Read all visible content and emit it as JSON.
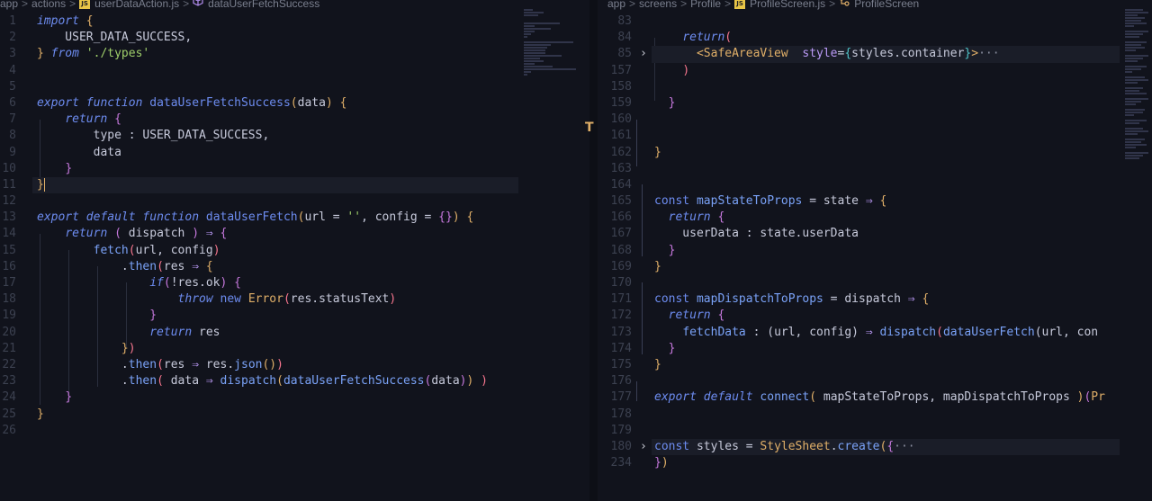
{
  "left": {
    "breadcrumb": [
      "app",
      "actions",
      "userDataAction.js",
      "dataUserFetchSuccess"
    ],
    "lines": [
      {
        "n": "1",
        "t": [
          [
            "kw",
            "import"
          ],
          [
            "pl",
            " "
          ],
          [
            "br1",
            "{"
          ]
        ]
      },
      {
        "n": "2",
        "t": [
          [
            "pl",
            "    USER_DATA_SUCCESS,"
          ]
        ]
      },
      {
        "n": "3",
        "t": [
          [
            "br1",
            "}"
          ],
          [
            "pl",
            " "
          ],
          [
            "kw",
            "from"
          ],
          [
            "pl",
            " "
          ],
          [
            "str",
            "'./types'"
          ]
        ]
      },
      {
        "n": "4",
        "t": []
      },
      {
        "n": "5",
        "t": []
      },
      {
        "n": "6",
        "t": [
          [
            "kw",
            "export"
          ],
          [
            "pl",
            " "
          ],
          [
            "kw",
            "function"
          ],
          [
            "pl",
            " "
          ],
          [
            "fn",
            "dataUserFetchSuccess"
          ],
          [
            "br1",
            "("
          ],
          [
            "pl",
            "data"
          ],
          [
            "br1",
            ")"
          ],
          [
            "pl",
            " "
          ],
          [
            "br1",
            "{"
          ]
        ]
      },
      {
        "n": "7",
        "t": [
          [
            "pl",
            "    "
          ],
          [
            "kw",
            "return"
          ],
          [
            "pl",
            " "
          ],
          [
            "br2",
            "{"
          ]
        ]
      },
      {
        "n": "8",
        "t": [
          [
            "pl",
            "        type : USER_DATA_SUCCESS,"
          ]
        ]
      },
      {
        "n": "9",
        "t": [
          [
            "pl",
            "        data"
          ]
        ]
      },
      {
        "n": "10",
        "t": [
          [
            "pl",
            "    "
          ],
          [
            "br2",
            "}"
          ]
        ]
      },
      {
        "n": "11",
        "t": [
          [
            "br1",
            "}"
          ]
        ],
        "hl": true,
        "cursor": true
      },
      {
        "n": "12",
        "t": []
      },
      {
        "n": "13",
        "t": [
          [
            "kw",
            "export"
          ],
          [
            "pl",
            " "
          ],
          [
            "kw",
            "default"
          ],
          [
            "pl",
            " "
          ],
          [
            "kw",
            "function"
          ],
          [
            "pl",
            " "
          ],
          [
            "fn",
            "dataUserFetch"
          ],
          [
            "br1",
            "("
          ],
          [
            "pl",
            "url = "
          ],
          [
            "str",
            "''"
          ],
          [
            "pl",
            ", config = "
          ],
          [
            "br2",
            "{}"
          ],
          [
            "br1",
            ")"
          ],
          [
            "pl",
            " "
          ],
          [
            "br1",
            "{"
          ]
        ]
      },
      {
        "n": "14",
        "t": [
          [
            "pl",
            "    "
          ],
          [
            "kw",
            "return"
          ],
          [
            "pl",
            " "
          ],
          [
            "br2",
            "("
          ],
          [
            "pl",
            " dispatch "
          ],
          [
            "br2",
            ")"
          ],
          [
            "pl",
            " "
          ],
          [
            "op",
            "⇒"
          ],
          [
            "pl",
            " "
          ],
          [
            "br2",
            "{"
          ]
        ]
      },
      {
        "n": "15",
        "t": [
          [
            "pl",
            "        "
          ],
          [
            "fnb",
            "fetch"
          ],
          [
            "br3",
            "("
          ],
          [
            "pl",
            "url, config"
          ],
          [
            "br3",
            ")"
          ]
        ]
      },
      {
        "n": "16",
        "t": [
          [
            "pl",
            "            ."
          ],
          [
            "fnb",
            "then"
          ],
          [
            "br3",
            "("
          ],
          [
            "pl",
            "res "
          ],
          [
            "op",
            "⇒"
          ],
          [
            "pl",
            " "
          ],
          [
            "br1",
            "{"
          ]
        ]
      },
      {
        "n": "17",
        "t": [
          [
            "pl",
            "                "
          ],
          [
            "kw",
            "if"
          ],
          [
            "br2",
            "("
          ],
          [
            "pl",
            "!res.ok"
          ],
          [
            "br2",
            ")"
          ],
          [
            "pl",
            " "
          ],
          [
            "br2",
            "{"
          ]
        ]
      },
      {
        "n": "18",
        "t": [
          [
            "pl",
            "                    "
          ],
          [
            "kw",
            "throw"
          ],
          [
            "pl",
            " "
          ],
          [
            "fn",
            "new"
          ],
          [
            "pl",
            " "
          ],
          [
            "cls",
            "Error"
          ],
          [
            "br3",
            "("
          ],
          [
            "pl",
            "res.statusText"
          ],
          [
            "br3",
            ")"
          ]
        ]
      },
      {
        "n": "19",
        "t": [
          [
            "pl",
            "                "
          ],
          [
            "br2",
            "}"
          ]
        ]
      },
      {
        "n": "20",
        "t": [
          [
            "pl",
            "                "
          ],
          [
            "kw",
            "return"
          ],
          [
            "pl",
            " res"
          ]
        ]
      },
      {
        "n": "21",
        "t": [
          [
            "pl",
            "            "
          ],
          [
            "br1",
            "}"
          ],
          [
            "br3",
            ")"
          ]
        ]
      },
      {
        "n": "22",
        "t": [
          [
            "pl",
            "            ."
          ],
          [
            "fnb",
            "then"
          ],
          [
            "br3",
            "("
          ],
          [
            "pl",
            "res "
          ],
          [
            "op",
            "⇒"
          ],
          [
            "pl",
            " res."
          ],
          [
            "fnb",
            "json"
          ],
          [
            "br1",
            "()"
          ],
          [
            "br3",
            ")"
          ]
        ]
      },
      {
        "n": "23",
        "t": [
          [
            "pl",
            "            ."
          ],
          [
            "fnb",
            "then"
          ],
          [
            "br3",
            "("
          ],
          [
            "pl",
            " data "
          ],
          [
            "op",
            "⇒"
          ],
          [
            "pl",
            " "
          ],
          [
            "fnb",
            "dispatch"
          ],
          [
            "br1",
            "("
          ],
          [
            "fnb",
            "dataUserFetchSuccess"
          ],
          [
            "br2",
            "("
          ],
          [
            "pl",
            "data"
          ],
          [
            "br2",
            ")"
          ],
          [
            "br1",
            ")"
          ],
          [
            "pl",
            " "
          ],
          [
            "br3",
            ")"
          ]
        ]
      },
      {
        "n": "24",
        "t": [
          [
            "pl",
            "    "
          ],
          [
            "br2",
            "}"
          ]
        ]
      },
      {
        "n": "25",
        "t": [
          [
            "br1",
            "}"
          ]
        ]
      },
      {
        "n": "26",
        "t": []
      }
    ]
  },
  "right": {
    "breadcrumb": [
      "app",
      "screens",
      "Profile",
      "ProfileScreen.js",
      "ProfileScreen"
    ],
    "lines": [
      {
        "n": "83",
        "t": []
      },
      {
        "n": "84",
        "t": [
          [
            "pl",
            "    "
          ],
          [
            "kw",
            "return"
          ],
          [
            "br3",
            "("
          ]
        ]
      },
      {
        "n": "85",
        "t": [
          [
            "pl",
            "      "
          ],
          [
            "tag",
            "<SafeAreaView"
          ],
          [
            "pl",
            "  "
          ],
          [
            "op",
            "style"
          ],
          [
            "pl",
            "="
          ],
          [
            "br4",
            "{"
          ],
          [
            "pl",
            "styles.container"
          ],
          [
            "br4",
            "}"
          ],
          [
            "tag",
            ">"
          ],
          [
            "dim",
            "···"
          ]
        ],
        "fold": true,
        "hl": true
      },
      {
        "n": "157",
        "t": [
          [
            "pl",
            "    "
          ],
          [
            "br3",
            ")"
          ]
        ]
      },
      {
        "n": "158",
        "t": []
      },
      {
        "n": "159",
        "t": [
          [
            "pl",
            "  "
          ],
          [
            "br2",
            "}"
          ]
        ]
      },
      {
        "n": "160",
        "t": []
      },
      {
        "n": "161",
        "t": []
      },
      {
        "n": "162",
        "t": [
          [
            "br1",
            "}"
          ]
        ]
      },
      {
        "n": "163",
        "t": []
      },
      {
        "n": "164",
        "t": []
      },
      {
        "n": "165",
        "t": [
          [
            "fn",
            "const"
          ],
          [
            "pl",
            " "
          ],
          [
            "fnb",
            "mapStateToProps"
          ],
          [
            "pl",
            " = state "
          ],
          [
            "op",
            "⇒"
          ],
          [
            "pl",
            " "
          ],
          [
            "br1",
            "{"
          ]
        ]
      },
      {
        "n": "166",
        "t": [
          [
            "pl",
            "  "
          ],
          [
            "kw",
            "return"
          ],
          [
            "pl",
            " "
          ],
          [
            "br2",
            "{"
          ]
        ]
      },
      {
        "n": "167",
        "t": [
          [
            "pl",
            "    userData : state.userData"
          ]
        ]
      },
      {
        "n": "168",
        "t": [
          [
            "pl",
            "  "
          ],
          [
            "br2",
            "}"
          ]
        ]
      },
      {
        "n": "169",
        "t": [
          [
            "br1",
            "}"
          ]
        ]
      },
      {
        "n": "170",
        "t": []
      },
      {
        "n": "171",
        "t": [
          [
            "fn",
            "const"
          ],
          [
            "pl",
            " "
          ],
          [
            "fnb",
            "mapDispatchToProps"
          ],
          [
            "pl",
            " = dispatch "
          ],
          [
            "op",
            "⇒"
          ],
          [
            "pl",
            " "
          ],
          [
            "br1",
            "{"
          ]
        ]
      },
      {
        "n": "172",
        "t": [
          [
            "pl",
            "  "
          ],
          [
            "kw",
            "return"
          ],
          [
            "pl",
            " "
          ],
          [
            "br2",
            "{"
          ]
        ]
      },
      {
        "n": "173",
        "t": [
          [
            "pl",
            "    "
          ],
          [
            "fnb",
            "fetchData"
          ],
          [
            "pl",
            " : (url, config) "
          ],
          [
            "op",
            "⇒"
          ],
          [
            "pl",
            " "
          ],
          [
            "fnb",
            "dispatch"
          ],
          [
            "br3",
            "("
          ],
          [
            "fnb",
            "dataUserFetch"
          ],
          [
            "pl",
            "(url, con"
          ]
        ]
      },
      {
        "n": "174",
        "t": [
          [
            "pl",
            "  "
          ],
          [
            "br2",
            "}"
          ]
        ]
      },
      {
        "n": "175",
        "t": [
          [
            "br1",
            "}"
          ]
        ]
      },
      {
        "n": "176",
        "t": []
      },
      {
        "n": "177",
        "t": [
          [
            "kw",
            "export"
          ],
          [
            "pl",
            " "
          ],
          [
            "kw",
            "default"
          ],
          [
            "pl",
            " "
          ],
          [
            "fnb",
            "connect"
          ],
          [
            "br1",
            "("
          ],
          [
            "pl",
            " mapStateToProps, mapDispatchToProps "
          ],
          [
            "br1",
            ")"
          ],
          [
            "br2",
            "("
          ],
          [
            "cls",
            "Pr"
          ]
        ]
      },
      {
        "n": "178",
        "t": []
      },
      {
        "n": "179",
        "t": []
      },
      {
        "n": "180",
        "t": [
          [
            "fn",
            "const"
          ],
          [
            "pl",
            " styles = "
          ],
          [
            "cls",
            "StyleSheet"
          ],
          [
            "pl",
            "."
          ],
          [
            "fnb",
            "create"
          ],
          [
            "br1",
            "("
          ],
          [
            "br2",
            "{"
          ],
          [
            "dim",
            "···"
          ]
        ],
        "fold": true,
        "hl": true
      },
      {
        "n": "234",
        "t": [
          [
            "br2",
            "}"
          ],
          [
            "br1",
            ")"
          ]
        ]
      },
      {
        "n": "",
        "t": []
      },
      {
        "n": "",
        "t": []
      },
      {
        "n": "",
        "t": []
      }
    ]
  }
}
